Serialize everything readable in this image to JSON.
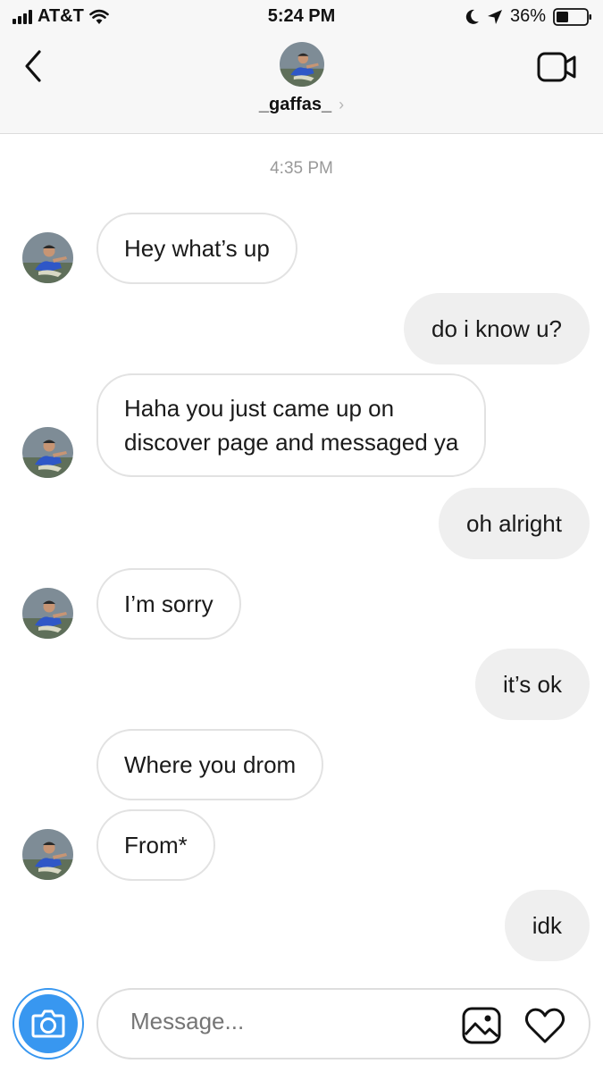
{
  "status_bar": {
    "carrier": "AT&T",
    "time": "5:24 PM",
    "battery": "36%",
    "icons": [
      "signal-icon",
      "wifi-icon",
      "moon-icon",
      "location-arrow-icon",
      "battery-icon"
    ]
  },
  "header": {
    "username": "_gaffas_",
    "chevron": "›",
    "icons": [
      "back-icon",
      "video-call-icon",
      "chevron-right-icon"
    ]
  },
  "conversation": {
    "timestamp": "4:35 PM",
    "messages": [
      {
        "from": "them",
        "text": "Hey what’s up"
      },
      {
        "from": "me",
        "text": "do i know u?"
      },
      {
        "from": "them",
        "lines": [
          "Haha you just came up on",
          "discover page and messaged ya"
        ]
      },
      {
        "from": "me",
        "text": "oh alright"
      },
      {
        "from": "them",
        "text": "I’m sorry"
      },
      {
        "from": "me",
        "text": "it’s ok"
      },
      {
        "from": "them",
        "text": "Where you drom"
      },
      {
        "from": "them",
        "text": "From*"
      },
      {
        "from": "me",
        "text": "idk"
      }
    ]
  },
  "composer": {
    "placeholder": "Message...",
    "icons": [
      "camera-icon",
      "gallery-icon",
      "heart-icon"
    ]
  },
  "colors": {
    "accent": "#3897f0",
    "incoming_border": "#e2e2e2",
    "outgoing_fill": "#efefef",
    "header_bg": "#f7f7f7"
  }
}
